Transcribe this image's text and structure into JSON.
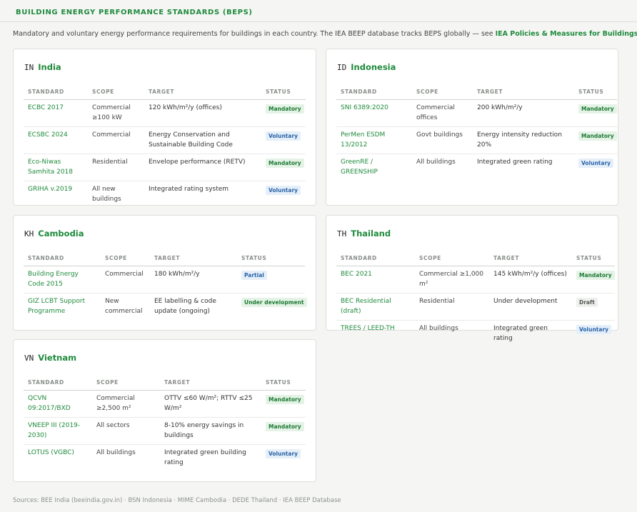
{
  "header": {
    "title": "BUILDING ENERGY PERFORMANCE STANDARDS (BEPS)",
    "intro_text": "Mandatory and voluntary energy performance requirements for buildings in each country. The IEA BEEP database tracks BEPS globally — see ",
    "intro_link": "IEA Policies & Measures for Buildings",
    "intro_end": "."
  },
  "columns": {
    "standard": "STANDARD",
    "scope": "SCOPE",
    "target": "TARGET",
    "status": "STATUS"
  },
  "countries": [
    {
      "code": "IN",
      "name": "India",
      "rows": [
        {
          "standard": "ECBC 2017",
          "scope": "Commercial ≥100 kW",
          "target": "120 kWh/m²/y (offices)",
          "status": "Mandatory"
        },
        {
          "standard": "ECSBC 2024",
          "scope": "Commercial",
          "target": "Energy Conservation and Sustainable Building Code",
          "status": "Voluntary"
        },
        {
          "standard": "Eco-Niwas Samhita 2018",
          "scope": "Residential",
          "target": "Envelope performance (RETV)",
          "status": "Mandatory"
        },
        {
          "standard": "GRIHA v.2019",
          "scope": "All new buildings",
          "target": "Integrated rating system",
          "status": "Voluntary"
        }
      ]
    },
    {
      "code": "ID",
      "name": "Indonesia",
      "rows": [
        {
          "standard": "SNI 6389:2020",
          "scope": "Commercial offices",
          "target": "200 kWh/m²/y",
          "status": "Mandatory"
        },
        {
          "standard": "PerMen ESDM 13/2012",
          "scope": "Govt buildings",
          "target": "Energy intensity reduction 20%",
          "status": "Mandatory"
        },
        {
          "standard": "GreenRE / GREENSHIP",
          "scope": "All buildings",
          "target": "Integrated green rating",
          "status": "Voluntary"
        }
      ]
    },
    {
      "code": "KH",
      "name": "Cambodia",
      "rows": [
        {
          "standard": "Building Energy Code 2015",
          "scope": "Commercial",
          "target": "180 kWh/m²/y",
          "status": "Partial"
        },
        {
          "standard": "GIZ LCBT Support Programme",
          "scope": "New commercial",
          "target": "EE labelling & code update (ongoing)",
          "status": "Under development"
        }
      ]
    },
    {
      "code": "TH",
      "name": "Thailand",
      "rows": [
        {
          "standard": "BEC 2021",
          "scope": "Commercial ≥1,000 m²",
          "target": "145 kWh/m²/y (offices)",
          "status": "Mandatory"
        },
        {
          "standard": "BEC Residential (draft)",
          "scope": "Residential",
          "target": "Under development",
          "status": "Draft"
        },
        {
          "standard": "TREES / LEED-TH",
          "scope": "All buildings",
          "target": "Integrated green rating",
          "status": "Voluntary"
        }
      ]
    },
    {
      "code": "VN",
      "name": "Vietnam",
      "rows": [
        {
          "standard": "QCVN 09:2017/BXD",
          "scope": "Commercial ≥2,500 m²",
          "target": "OTTV ≤60 W/m²; RTTV ≤25 W/m²",
          "status": "Mandatory"
        },
        {
          "standard": "VNEEP III (2019-2030)",
          "scope": "All sectors",
          "target": "8-10% energy savings in buildings",
          "status": "Mandatory"
        },
        {
          "standard": "LOTUS (VGBC)",
          "scope": "All buildings",
          "target": "Integrated green building rating",
          "status": "Voluntary"
        }
      ]
    }
  ],
  "footer": {
    "sources": "Sources: BEE India (beeindia.gov.in) · BSN Indonesia · MIME Cambodia · DEDE Thailand · IEA BEEP Database"
  }
}
